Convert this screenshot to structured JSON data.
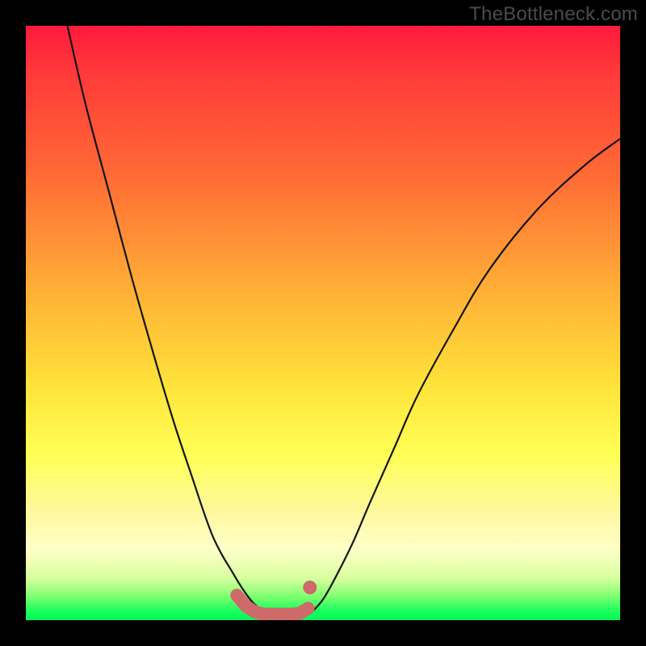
{
  "watermark": "TheBottleneck.com",
  "colors": {
    "background": "#000000",
    "curve_stroke": "#1a1a1a",
    "marker_fill": "#cf6a6a",
    "marker_stroke": "#c85f5f"
  },
  "chart_data": {
    "type": "line",
    "title": "",
    "xlabel": "",
    "ylabel": "",
    "xlim": [
      0,
      100
    ],
    "ylim": [
      0,
      100
    ],
    "grid": false,
    "legend": false,
    "series": [
      {
        "name": "left-curve",
        "x": [
          7,
          10,
          14,
          18,
          22,
          25,
          28,
          30,
          31.5,
          33,
          34.5,
          36,
          37,
          38,
          39,
          40
        ],
        "values": [
          100,
          87,
          72,
          57,
          43,
          33,
          24,
          18,
          14,
          11,
          8.5,
          6,
          4.5,
          3.2,
          2.2,
          1.2
        ]
      },
      {
        "name": "right-curve",
        "x": [
          48,
          50,
          52,
          55,
          58,
          62,
          66,
          72,
          78,
          86,
          94,
          100
        ],
        "values": [
          1.2,
          3.5,
          7,
          13,
          20,
          29,
          38,
          49,
          59,
          69,
          76.5,
          81
        ]
      },
      {
        "name": "trough-markers",
        "x": [
          35.5,
          37,
          38.5,
          40,
          41.5,
          43,
          44.5,
          46,
          47.5,
          47.8
        ],
        "values": [
          4.2,
          2.4,
          1.4,
          1.0,
          1.0,
          1.0,
          1.0,
          1.1,
          2.0,
          5.5
        ]
      }
    ]
  }
}
